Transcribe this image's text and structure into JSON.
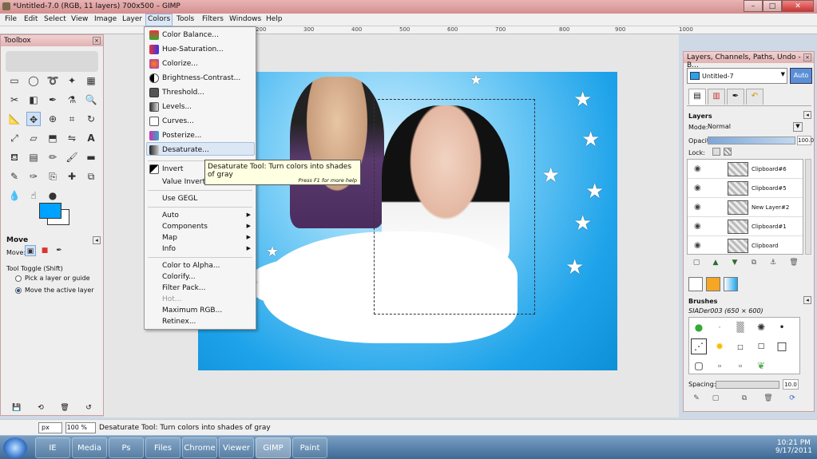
{
  "window": {
    "title": "*Untitled-7.0 (RGB, 11 layers) 700x500 – GIMP",
    "buttons": {
      "minimize": "–",
      "maximize": "□",
      "close": "✕"
    }
  },
  "menubar": {
    "items": [
      "File",
      "Edit",
      "Select",
      "View",
      "Image",
      "Layer",
      "Colors",
      "Tools",
      "Filters",
      "Windows",
      "Help"
    ]
  },
  "ruler": {
    "ticks": [
      "100",
      "200",
      "300",
      "400",
      "500",
      "600",
      "700",
      "800",
      "900",
      "1000"
    ]
  },
  "colors_menu": {
    "items": [
      {
        "label": "Color Balance...",
        "icon": "color-balance-icon"
      },
      {
        "label": "Hue-Saturation...",
        "icon": "hue-saturation-icon"
      },
      {
        "label": "Colorize...",
        "icon": "colorize-icon"
      },
      {
        "label": "Brightness-Contrast...",
        "icon": "brightness-contrast-icon"
      },
      {
        "label": "Threshold...",
        "icon": "threshold-icon"
      },
      {
        "label": "Levels...",
        "icon": "levels-icon"
      },
      {
        "label": "Curves...",
        "icon": "curves-icon"
      },
      {
        "label": "Posterize...",
        "icon": "posterize-icon"
      },
      {
        "label": "Desaturate...",
        "icon": "desaturate-icon"
      },
      {
        "label": "Invert",
        "icon": "invert-icon"
      },
      {
        "label": "Value Invert",
        "icon": ""
      },
      {
        "label": "Use GEGL",
        "icon": ""
      },
      {
        "label": "Auto",
        "icon": "",
        "submenu": true
      },
      {
        "label": "Components",
        "icon": "",
        "submenu": true
      },
      {
        "label": "Map",
        "icon": "",
        "submenu": true
      },
      {
        "label": "Info",
        "icon": "",
        "submenu": true
      },
      {
        "label": "Color to Alpha...",
        "icon": ""
      },
      {
        "label": "Colorify...",
        "icon": ""
      },
      {
        "label": "Filter Pack...",
        "icon": ""
      },
      {
        "label": "Hot...",
        "icon": "",
        "disabled": true
      },
      {
        "label": "Maximum RGB...",
        "icon": ""
      },
      {
        "label": "Retinex...",
        "icon": ""
      }
    ]
  },
  "tooltip": {
    "text": "Desaturate Tool: Turn colors into shades of gray",
    "hint": "Press F1 for more help"
  },
  "toolbox": {
    "title": "Toolbox",
    "tool_options_title": "Move",
    "move_label": "Move:",
    "tool_toggle": "Tool Toggle  (Shift)",
    "radio1": "Pick a layer or guide",
    "radio2": "Move the active layer",
    "fg_color": "#00a2ff",
    "bg_color": "#ffffff"
  },
  "layers_panel": {
    "title": "Layers, Channels, Paths, Undo - B...",
    "image_name": "Untitled-7",
    "auto_label": "Auto",
    "layers_label": "Layers",
    "mode_label": "Mode:",
    "mode_value": "Normal",
    "opacity_label": "Opacity:",
    "opacity_value": "100.0",
    "lock_label": "Lock:",
    "layers": [
      "Clipboard#6",
      "Clipboard#5",
      "New Layer#2",
      "Clipboard#1",
      "Clipboard"
    ],
    "brushes_label": "Brushes",
    "brush_name": "SIADer003 (650 × 600)",
    "spacing_label": "Spacing:",
    "spacing_value": "10.0"
  },
  "statusbar": {
    "unit": "px",
    "zoom": "100 %",
    "message": "Desaturate Tool: Turn colors into shades of gray"
  },
  "taskbar": {
    "apps": [
      "IE",
      "Media",
      "Ps",
      "Files",
      "Chrome",
      "Viewer",
      "GIMP",
      "Paint"
    ],
    "time": "10:21 PM",
    "date": "9/17/2011"
  }
}
